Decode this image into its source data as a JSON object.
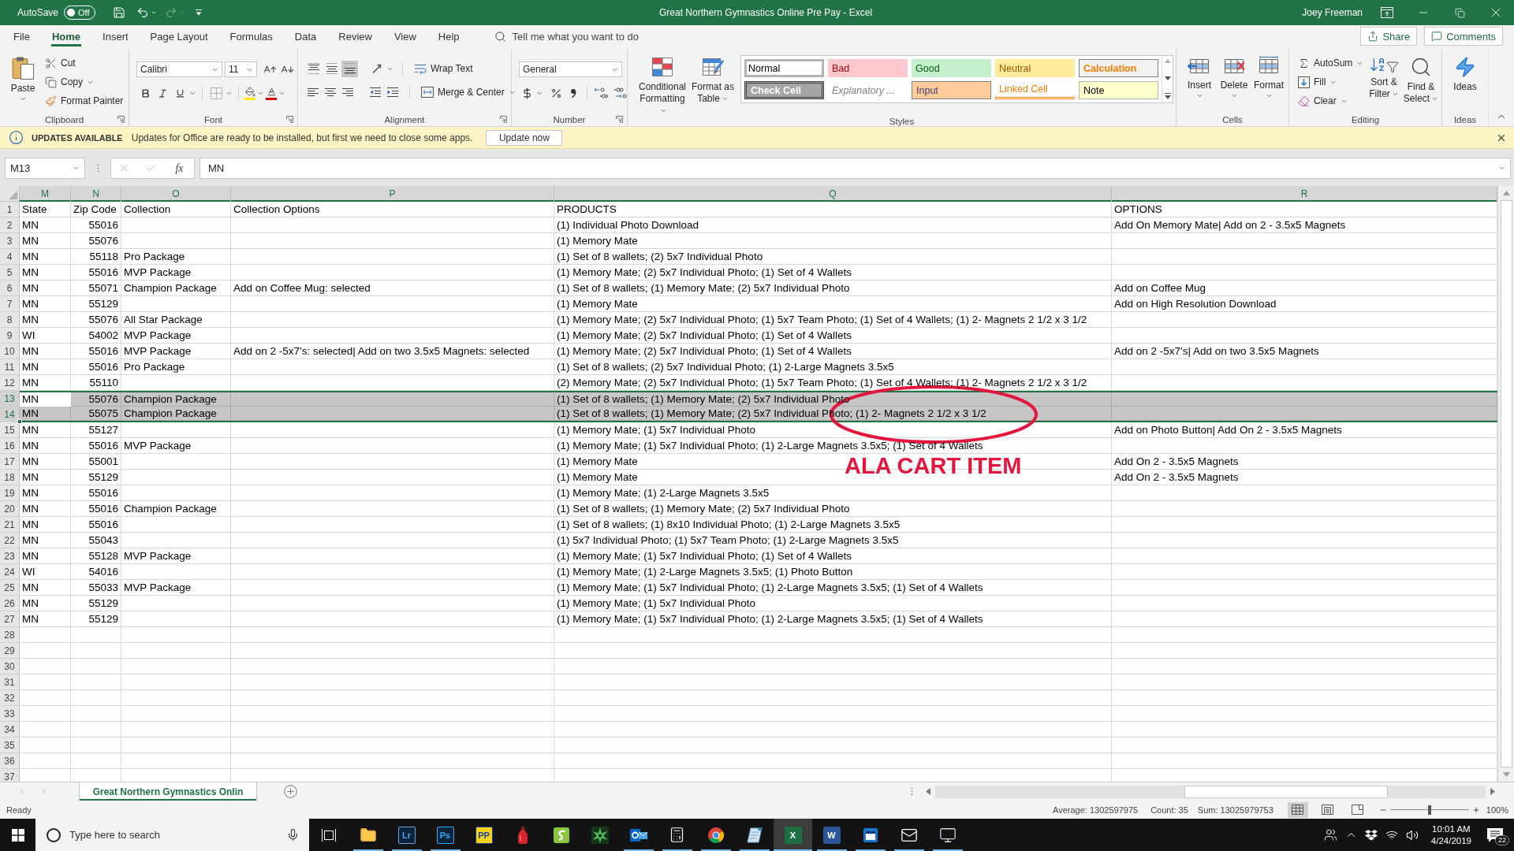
{
  "title_bar": {
    "autosave": {
      "label": "AutoSave",
      "state": "Off",
      "on": false
    },
    "redo": {
      "disabled": true
    },
    "title": "Great Northern Gymnastics Online Pre Pay - Excel",
    "user": "Joey Freeman"
  },
  "ribbon_tabs": [
    {
      "label": "File",
      "selected": false
    },
    {
      "label": "Home",
      "selected": true
    },
    {
      "label": "Insert",
      "selected": false
    },
    {
      "label": "Page Layout",
      "selected": false
    },
    {
      "label": "Formulas",
      "selected": false
    },
    {
      "label": "Data",
      "selected": false
    },
    {
      "label": "Review",
      "selected": false
    },
    {
      "label": "View",
      "selected": false
    },
    {
      "label": "Help",
      "selected": false
    }
  ],
  "tell_me": {
    "placeholder": "Tell me what you want to do"
  },
  "share_button": "Share",
  "comments_button": "Comments",
  "ribbon": {
    "clipboard": {
      "title": "Clipboard",
      "paste": "Paste",
      "cut": "Cut",
      "copy": "Copy",
      "format_painter": "Format Painter"
    },
    "font": {
      "title": "Font",
      "font_name": "Calibri",
      "font_size": "11"
    },
    "alignment": {
      "title": "Alignment",
      "vertical": [
        {
          "kind": "top",
          "selected": false
        },
        {
          "kind": "middle",
          "selected": false
        },
        {
          "kind": "bottom",
          "selected": true
        }
      ],
      "wrap_text": "Wrap Text",
      "merge_center": "Merge & Center"
    },
    "number": {
      "title": "Number",
      "format": "General"
    },
    "styles": {
      "title": "Styles",
      "conditional_formatting": "Conditional Formatting",
      "format_as_table": "Format as Table",
      "gallery": [
        {
          "label": "Normal",
          "kind": "normal",
          "selected": true
        },
        {
          "label": "Bad",
          "kind": "bad",
          "selected": false
        },
        {
          "label": "Good",
          "kind": "good",
          "selected": false
        },
        {
          "label": "Neutral",
          "kind": "neutral",
          "selected": false
        },
        {
          "label": "Calculation",
          "kind": "calculation",
          "selected": false
        },
        {
          "label": "Check Cell",
          "kind": "check",
          "selected": false
        },
        {
          "label": "Explanatory ...",
          "kind": "explanatory",
          "selected": false
        },
        {
          "label": "Input",
          "kind": "input",
          "selected": false
        },
        {
          "label": "Linked Cell",
          "kind": "linked",
          "selected": false
        },
        {
          "label": "Note",
          "kind": "note",
          "selected": false
        }
      ]
    },
    "cells": {
      "title": "Cells",
      "buttons": [
        {
          "label": "Insert",
          "kind": "insert"
        },
        {
          "label": "Delete",
          "kind": "delete"
        },
        {
          "label": "Format",
          "kind": "format"
        }
      ]
    },
    "editing": {
      "title": "Editing",
      "autosum": "AutoSum",
      "fill": "Fill",
      "clear": "Clear",
      "sort_filter": "Sort & Filter",
      "find_select": "Find & Select"
    },
    "ideas": {
      "title": "Ideas",
      "button": "Ideas"
    }
  },
  "update_bar": {
    "title": "UPDATES AVAILABLE",
    "message": "Updates for Office are ready to be installed, but first we need to close some apps.",
    "button": "Update now"
  },
  "formula_bar": {
    "name_box": "M13",
    "function_label": "fx",
    "value": "MN"
  },
  "sheet": {
    "columns": [
      {
        "letter": "M",
        "selected": true,
        "active": true
      },
      {
        "letter": "N",
        "selected": true,
        "active": false
      },
      {
        "letter": "O",
        "selected": true,
        "active": false
      },
      {
        "letter": "P",
        "selected": true,
        "active": false
      },
      {
        "letter": "Q",
        "selected": true,
        "active": false
      },
      {
        "letter": "R",
        "selected": true,
        "active": false
      }
    ],
    "rows": [
      {
        "number": "1",
        "selected": false,
        "active": false,
        "cells": {
          "M": "State",
          "N": "Zip Code",
          "O": "Collection",
          "P": "Collection Options",
          "Q": "PRODUCTS",
          "R": "OPTIONS"
        }
      },
      {
        "number": "2",
        "selected": false,
        "active": false,
        "cells": {
          "M": "MN",
          "N": "55016",
          "Q": "(1) Individual Photo Download",
          "R": "Add On Memory Mate| Add on 2 - 3.5x5 Magnets"
        }
      },
      {
        "number": "3",
        "selected": false,
        "active": false,
        "cells": {
          "M": "MN",
          "N": "55076",
          "Q": "(1) Memory Mate"
        }
      },
      {
        "number": "4",
        "selected": false,
        "active": false,
        "cells": {
          "M": "MN",
          "N": "55118",
          "O": "Pro Package",
          "Q": "(1) Set of 8 wallets; (2) 5x7 Individual Photo"
        }
      },
      {
        "number": "5",
        "selected": false,
        "active": false,
        "cells": {
          "M": "MN",
          "N": "55016",
          "O": "MVP Package",
          "Q": "(1) Memory Mate; (2) 5x7 Individual Photo; (1) Set of 4 Wallets"
        }
      },
      {
        "number": "6",
        "selected": false,
        "active": false,
        "cells": {
          "M": "MN",
          "N": "55071",
          "O": "Champion Package",
          "P": "Add on Coffee Mug: selected",
          "Q": "(1) Set of 8 wallets; (1) Memory Mate; (2) 5x7 Individual Photo",
          "R": "Add on Coffee Mug"
        }
      },
      {
        "number": "7",
        "selected": false,
        "active": false,
        "cells": {
          "M": "MN",
          "N": "55129",
          "Q": "(1) Memory Mate",
          "R": "Add on High Resolution Download"
        }
      },
      {
        "number": "8",
        "selected": false,
        "active": false,
        "cells": {
          "M": "MN",
          "N": "55076",
          "O": "All Star Package",
          "Q": "(1) Memory Mate; (2) 5x7 Individual Photo; (1) 5x7 Team Photo; (1) Set of 4 Wallets; (1) 2- Magnets 2 1/2 x 3 1/2"
        }
      },
      {
        "number": "9",
        "selected": false,
        "active": false,
        "cells": {
          "M": "WI",
          "N": "54002",
          "O": "MVP Package",
          "Q": "(1) Memory Mate; (2) 5x7 Individual Photo; (1) Set of 4 Wallets"
        }
      },
      {
        "number": "10",
        "selected": false,
        "active": false,
        "cells": {
          "M": "MN",
          "N": "55016",
          "O": "MVP Package",
          "P": "Add on 2 -5x7's: selected| Add on two 3.5x5 Magnets: selected",
          "Q": "(1) Memory Mate; (2) 5x7 Individual Photo; (1) Set of 4 Wallets",
          "R": "Add on 2 -5x7's| Add on two 3.5x5 Magnets"
        }
      },
      {
        "number": "11",
        "selected": false,
        "active": false,
        "cells": {
          "M": "MN",
          "N": "55016",
          "O": "Pro Package",
          "Q": "(1) Set of 8 wallets; (2) 5x7 Individual Photo; (1) 2-Large Magnets 3.5x5"
        }
      },
      {
        "number": "12",
        "selected": false,
        "active": false,
        "cells": {
          "M": "MN",
          "N": "55110",
          "Q": "(2) Memory Mate; (2) 5x7 Individual Photo; (1) 5x7 Team Photo; (1) Set of 4 Wallets; (1) 2- Magnets 2 1/2 x 3 1/2"
        }
      },
      {
        "number": "13",
        "selected": true,
        "active": true,
        "cells": {
          "M": "MN",
          "N": "55076",
          "O": "Champion Package",
          "Q": "(1) Set of 8 wallets; (1) Memory Mate; (2) 5x7 Individual Photo"
        }
      },
      {
        "number": "14",
        "selected": true,
        "active": false,
        "cells": {
          "M": "MN",
          "N": "55075",
          "O": "Champion Package",
          "Q": "(1) Set of 8 wallets; (1) Memory Mate; (2) 5x7 Individual Photo; (1) 2- Magnets 2 1/2 x 3 1/2"
        }
      },
      {
        "number": "15",
        "selected": false,
        "active": false,
        "cells": {
          "M": "MN",
          "N": "55127",
          "Q": "(1) Memory Mate; (1) 5x7 Individual Photo",
          "R": "Add on Photo Button| Add On 2 - 3.5x5 Magnets"
        }
      },
      {
        "number": "16",
        "selected": false,
        "active": false,
        "cells": {
          "M": "MN",
          "N": "55016",
          "O": "MVP Package",
          "Q": "(1) Memory Mate; (1) 5x7 Individual Photo; (1) 2-Large Magnets 3.5x5; (1) Set of 4 Wallets"
        }
      },
      {
        "number": "17",
        "selected": false,
        "active": false,
        "cells": {
          "M": "MN",
          "N": "55001",
          "Q": "(1) Memory Mate",
          "R": "Add On 2 - 3.5x5 Magnets"
        }
      },
      {
        "number": "18",
        "selected": false,
        "active": false,
        "cells": {
          "M": "MN",
          "N": "55129",
          "Q": "(1) Memory Mate",
          "R": "Add On 2 - 3.5x5 Magnets"
        }
      },
      {
        "number": "19",
        "selected": false,
        "active": false,
        "cells": {
          "M": "MN",
          "N": "55016",
          "Q": "(1) Memory Mate; (1) 2-Large Magnets 3.5x5"
        }
      },
      {
        "number": "20",
        "selected": false,
        "active": false,
        "cells": {
          "M": "MN",
          "N": "55016",
          "O": "Champion Package",
          "Q": "(1) Set of 8 wallets; (1) Memory Mate; (2) 5x7 Individual Photo"
        }
      },
      {
        "number": "21",
        "selected": false,
        "active": false,
        "cells": {
          "M": "MN",
          "N": "55016",
          "Q": "(1) Set of 8 wallets; (1) 8x10 Individual Photo; (1) 2-Large Magnets 3.5x5"
        }
      },
      {
        "number": "22",
        "selected": false,
        "active": false,
        "cells": {
          "M": "MN",
          "N": "55043",
          "Q": "(1) 5x7 Individual Photo; (1) 5x7 Team Photo; (1) 2-Large Magnets 3.5x5"
        }
      },
      {
        "number": "23",
        "selected": false,
        "active": false,
        "cells": {
          "M": "MN",
          "N": "55128",
          "O": "MVP Package",
          "Q": "(1) Memory Mate; (1) 5x7 Individual Photo; (1) Set of 4 Wallets"
        }
      },
      {
        "number": "24",
        "selected": false,
        "active": false,
        "cells": {
          "M": "WI",
          "N": "54016",
          "Q": "(1) Memory Mate; (1) 2-Large Magnets 3.5x5; (1) Photo Button"
        }
      },
      {
        "number": "25",
        "selected": false,
        "active": false,
        "cells": {
          "M": "MN",
          "N": "55033",
          "O": "MVP Package",
          "Q": "(1) Memory Mate; (1) 5x7 Individual Photo; (1) 2-Large Magnets 3.5x5; (1) Set of 4 Wallets"
        }
      },
      {
        "number": "26",
        "selected": false,
        "active": false,
        "cells": {
          "M": "MN",
          "N": "55129",
          "Q": "(1) Memory Mate; (1) 5x7 Individual Photo"
        }
      },
      {
        "number": "27",
        "selected": false,
        "active": false,
        "cells": {
          "M": "MN",
          "N": "55129",
          "Q": "(1) Memory Mate; (1) 5x7 Individual Photo; (1) 2-Large Magnets 3.5x5; (1) Set of 4 Wallets"
        }
      },
      {
        "number": "28",
        "selected": false,
        "active": false
      },
      {
        "number": "29",
        "selected": false,
        "active": false
      },
      {
        "number": "30",
        "selected": false,
        "active": false
      },
      {
        "number": "31",
        "selected": false,
        "active": false
      },
      {
        "number": "32",
        "selected": false,
        "active": false
      },
      {
        "number": "33",
        "selected": false,
        "active": false
      },
      {
        "number": "34",
        "selected": false,
        "active": false
      },
      {
        "number": "35",
        "selected": false,
        "active": false
      },
      {
        "number": "36",
        "selected": false,
        "active": false
      },
      {
        "number": "37",
        "selected": false,
        "active": false
      }
    ]
  },
  "annotation": {
    "text": "ALA CART ITEM"
  },
  "sheet_tabs": [
    {
      "label": "Great Northern Gymnastics Onlin",
      "selected": true
    }
  ],
  "status_bar": {
    "mode": "Ready",
    "average": "Average: 1302597975",
    "count": "Count: 35",
    "sum": "Sum: 13025979753",
    "views": [
      {
        "kind": "normal",
        "selected": true
      },
      {
        "kind": "page-layout",
        "selected": false
      },
      {
        "kind": "page-break",
        "selected": false
      }
    ],
    "zoom": {
      "level": 0.5,
      "label": "100%"
    }
  },
  "taskbar": {
    "search": {
      "placeholder": "Type here to search"
    },
    "apps": [
      {
        "kind": "folder",
        "selected": false,
        "running": true
      },
      {
        "kind": "outlined-tile",
        "text": "Lr",
        "color": "#58a6e8",
        "selected": false,
        "running": true
      },
      {
        "kind": "outlined-tile",
        "text": "Ps",
        "color": "#31a8ff",
        "selected": false,
        "running": true
      },
      {
        "kind": "light-tile",
        "text": "PP",
        "color": "#f2d21b",
        "selected": false,
        "running": false
      },
      {
        "kind": "bottle",
        "selected": false,
        "running": false
      },
      {
        "kind": "square-app",
        "selected": false,
        "running": false
      },
      {
        "kind": "burst",
        "selected": false,
        "running": false
      },
      {
        "kind": "mail-app",
        "selected": false,
        "running": true
      },
      {
        "kind": "calculator",
        "selected": false,
        "running": true
      },
      {
        "kind": "browser",
        "selected": false,
        "running": true
      },
      {
        "kind": "notepad",
        "selected": false,
        "running": true
      },
      {
        "kind": "tile",
        "text": "X",
        "color": "#1d6f42",
        "selected": true,
        "running": true
      },
      {
        "kind": "tile",
        "text": "W",
        "color": "#2b579a",
        "selected": false,
        "running": true
      },
      {
        "kind": "window",
        "selected": false,
        "running": true
      },
      {
        "kind": "envelope",
        "selected": false,
        "running": true
      },
      {
        "kind": "monitor",
        "selected": false,
        "running": true
      }
    ],
    "time": "10:01 AM",
    "date": "4/24/2019",
    "notifications": "22"
  }
}
